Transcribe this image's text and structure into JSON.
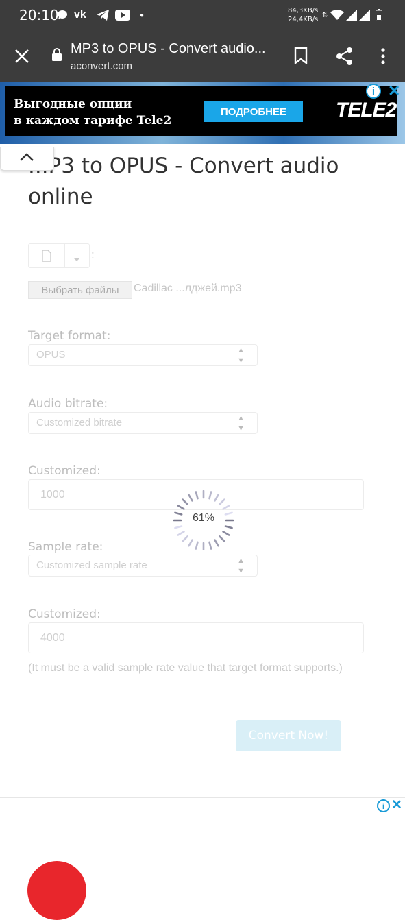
{
  "status": {
    "time": "20:10",
    "net_down": "84,3KB/s",
    "net_up": "24,4KB/s"
  },
  "browser": {
    "title": "MP3 to OPUS - Convert audio...",
    "url": "aconvert.com"
  },
  "ad_top": {
    "line1": "Выгодные опции",
    "line2": "в каждом тарифе Tele2",
    "button": "ПОДРОБНЕЕ",
    "logo": "TELE2",
    "info": "i",
    "close": "✕"
  },
  "page": {
    "title_visible": "...P3 to OPUS - Convert audio online"
  },
  "form": {
    "file_colon": ":",
    "choose_button": "Выбрать файлы",
    "file_name": "Cadillac  ...лджей.mp3",
    "target_format_label": "Target format:",
    "target_format_value": "OPUS",
    "bitrate_label": "Audio bitrate:",
    "bitrate_value": "Customized bitrate",
    "customized_label_1": "Customized:",
    "customized_value_1": "1000",
    "sample_rate_label": "Sample rate:",
    "sample_rate_value": "Customized sample rate",
    "customized_label_2": "Customized:",
    "customized_value_2": "4000",
    "note": "(It must be a valid sample rate value that target format supports.)",
    "convert_button": "Convert Now!"
  },
  "progress": {
    "percent_text": "61%",
    "value": 0.61
  },
  "ad_bottom": {
    "info": "i",
    "close": "✕"
  },
  "colors": {
    "bar_bg": "#3c3c3c",
    "ad_button": "#1aa6e8",
    "info_blue": "#1a9bd7",
    "red": "#e8262c"
  }
}
